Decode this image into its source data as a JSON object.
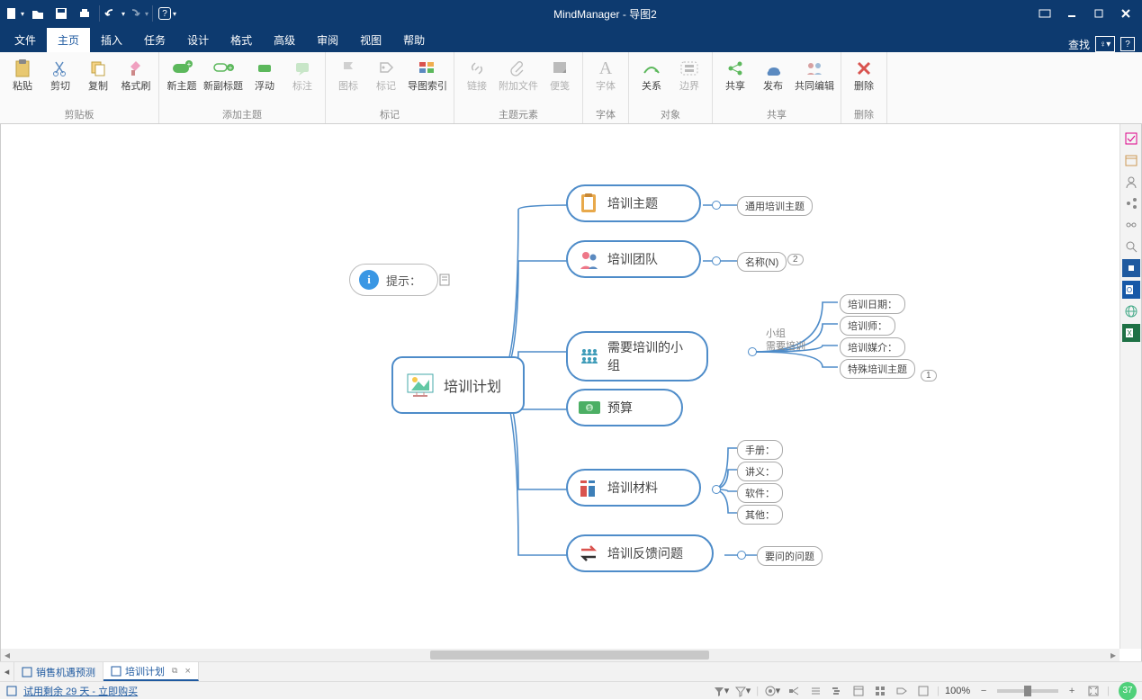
{
  "app": {
    "title": "MindManager - 导图2"
  },
  "tabs": {
    "file": "文件",
    "home": "主页",
    "insert": "插入",
    "tasks": "任务",
    "design": "设计",
    "format": "格式",
    "advanced": "高级",
    "review": "审阅",
    "view": "视图",
    "help": "帮助",
    "search": "查找"
  },
  "ribbon": {
    "clipboard": {
      "paste": "粘贴",
      "cut": "剪切",
      "copy": "复制",
      "formatpaint": "格式刷",
      "label": "剪贴板"
    },
    "addtopic": {
      "newtopic": "新主题",
      "newsubtopic": "新副标题",
      "float": "浮动",
      "callout": "标注",
      "label": "添加主题"
    },
    "markers": {
      "icon": "图标",
      "tag": "标记",
      "mapindex": "导图索引",
      "label": "标记"
    },
    "elements": {
      "link": "链接",
      "attach": "附加文件",
      "note": "便笺",
      "label": "主题元素"
    },
    "font": {
      "font": "字体",
      "label": "字体"
    },
    "object": {
      "relation": "关系",
      "boundary": "边界",
      "label": "对象"
    },
    "share": {
      "share": "共享",
      "publish": "发布",
      "coedit": "共同编辑",
      "label": "共享"
    },
    "delete": {
      "delete": "删除",
      "label": "删除"
    }
  },
  "map": {
    "central": "培训计划",
    "hint": "提示：",
    "topics": {
      "t1": "培训主题",
      "t2": "培训团队",
      "t3": "需要培训的小组",
      "t4": "预算",
      "t5": "培训材料",
      "t6": "培训反馈问题"
    },
    "subs": {
      "s1": "通用培训主题",
      "s2": "名称(N)",
      "s3lbl1": "小组",
      "s3lbl2": "需要培训",
      "s3a": "培训日期：",
      "s3b": "培训师：",
      "s3c": "培训媒介：",
      "s3d": "特殊培训主题",
      "s5a": "手册：",
      "s5b": "讲义：",
      "s5c": "软件：",
      "s5d": "其他：",
      "s6": "要问的问题"
    },
    "badges": {
      "b2": "2",
      "b3d": "1"
    }
  },
  "doctabs": {
    "t1": "销售机遇预测",
    "t2": "培训计划"
  },
  "status": {
    "trial": "试用剩余 29 天 - 立即购买",
    "zoom": "100%"
  }
}
